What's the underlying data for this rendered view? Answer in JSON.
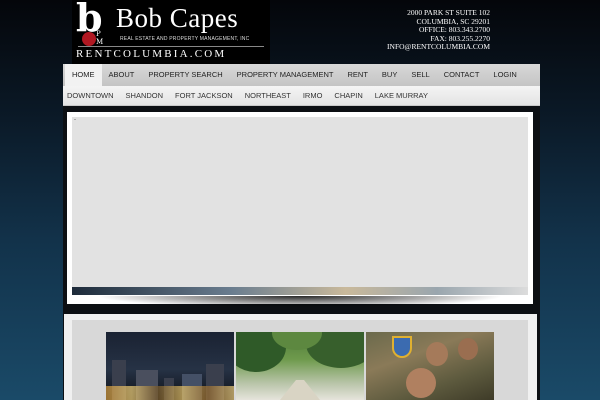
{
  "header": {
    "logo": {
      "mark_letter": "b",
      "mark_initials": "P\nM",
      "title": "Bob Capes",
      "subtitle": "REAL ESTATE AND PROPERTY MANAGEMENT, INC",
      "url": "RENTCOLUMBIA.COM"
    },
    "contact": {
      "address_line1": "2000 PARK ST SUITE 102",
      "address_line2": "COLUMBIA, SC 29201",
      "office": "OFFICE: 803.343.2700",
      "fax": "FAX: 803.255.2270",
      "email": "INFO@RENTCOLUMBIA.COM"
    }
  },
  "main_nav": {
    "items": [
      {
        "label": "HOME",
        "active": true
      },
      {
        "label": "ABOUT"
      },
      {
        "label": "PROPERTY SEARCH"
      },
      {
        "label": "PROPERTY MANAGEMENT"
      },
      {
        "label": "RENT"
      },
      {
        "label": "BUY"
      },
      {
        "label": "SELL"
      },
      {
        "label": "CONTACT"
      },
      {
        "label": "LOGIN"
      }
    ]
  },
  "sub_nav": {
    "items": [
      {
        "label": "DOWNTOWN"
      },
      {
        "label": "SHANDON"
      },
      {
        "label": "FORT JACKSON"
      },
      {
        "label": "NORTHEAST"
      },
      {
        "label": "IRMO"
      },
      {
        "label": "CHAPIN"
      },
      {
        "label": "LAKE MURRAY"
      }
    ]
  },
  "gallery": {
    "thumbs": [
      "downtown-skyline-photo",
      "tree-lined-street-photo",
      "fort-jackson-soldiers-photo"
    ]
  },
  "colors": {
    "accent_red": "#b01822",
    "nav_bg": "#cfcfcf",
    "background_top": "#04060a",
    "background_bottom": "#1a4a68"
  }
}
